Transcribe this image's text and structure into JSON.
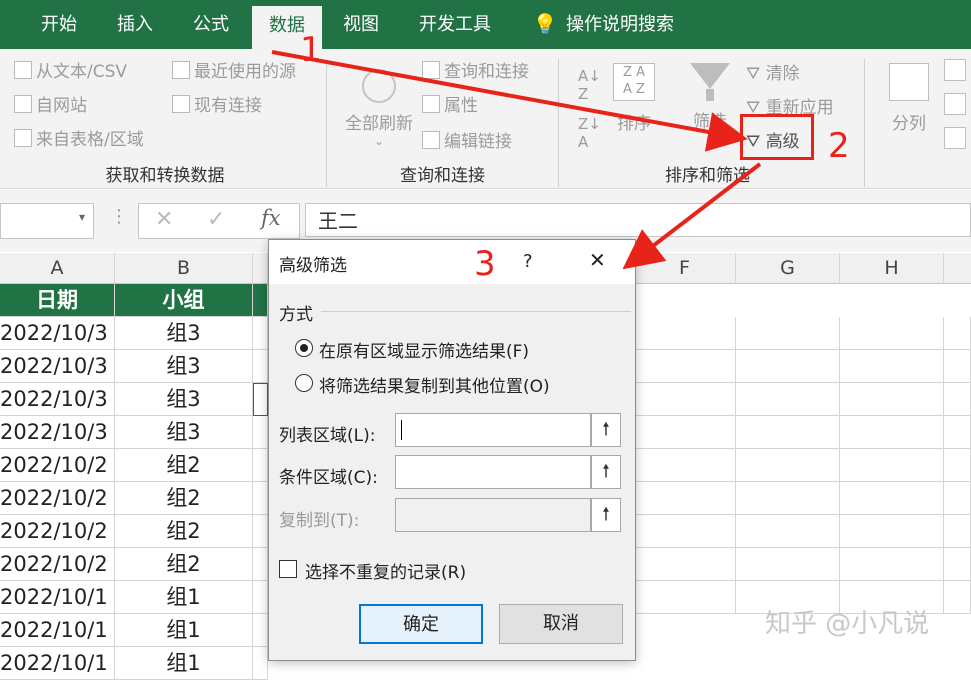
{
  "tabs": [
    "开始",
    "插入",
    "公式",
    "数据",
    "视图",
    "开发工具",
    "操作说明搜索"
  ],
  "active_tab": "数据",
  "ribbon": {
    "get_transform": {
      "from_text": "从文本/CSV",
      "from_web": "自网站",
      "from_table": "来自表格/区域",
      "recent_sources": "最近使用的源",
      "existing_connections": "现有连接",
      "group_label": "获取和转换数据"
    },
    "queries": {
      "refresh_all": "全部刷新",
      "queries_connections": "查询和连接",
      "properties": "属性",
      "edit_links": "编辑链接",
      "group_label": "查询和连接"
    },
    "sort_filter": {
      "sort": "排序",
      "filter": "筛选",
      "clear": "清除",
      "reapply": "重新应用",
      "advanced": "高级",
      "group_label": "排序和筛选"
    },
    "data_tools": {
      "text_to_columns": "分列"
    }
  },
  "formula_bar": {
    "value": "王二",
    "fx": "fx"
  },
  "sheet": {
    "columns": [
      "A",
      "B",
      "F",
      "G",
      "H"
    ],
    "header_row": [
      "日期",
      "小组"
    ],
    "rows": [
      [
        "2022/10/3",
        "组3"
      ],
      [
        "2022/10/3",
        "组3"
      ],
      [
        "2022/10/3",
        "组3"
      ],
      [
        "2022/10/3",
        "组3"
      ],
      [
        "2022/10/2",
        "组2"
      ],
      [
        "2022/10/2",
        "组2"
      ],
      [
        "2022/10/2",
        "组2"
      ],
      [
        "2022/10/2",
        "组2"
      ],
      [
        "2022/10/1",
        "组1"
      ],
      [
        "2022/10/1",
        "组1"
      ],
      [
        "2022/10/1",
        "组1"
      ]
    ]
  },
  "dialog": {
    "title": "高级筛选",
    "help": "?",
    "close": "✕",
    "section": "方式",
    "option_inplace": "在原有区域显示筛选结果(F)",
    "option_copy": "将筛选结果复制到其他位置(O)",
    "list_range_label": "列表区域(L):",
    "criteria_range_label": "条件区域(C):",
    "copy_to_label": "复制到(T):",
    "unique_records": "选择不重复的记录(R)",
    "ok": "确定",
    "cancel": "取消"
  },
  "annotations": {
    "step1": "1",
    "step2": "2",
    "step3": "3",
    "color": "#e8241a"
  },
  "watermark": "知乎 @小凡说",
  "colors": {
    "accent": "#217346"
  }
}
